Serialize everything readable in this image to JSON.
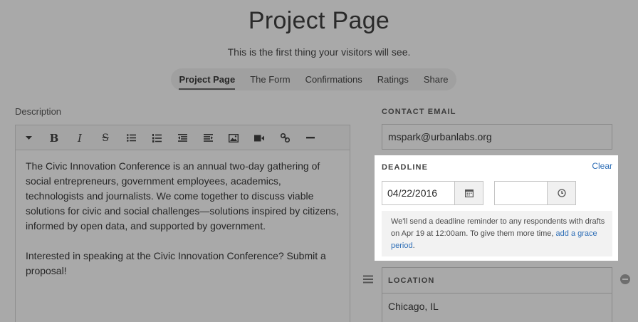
{
  "header": {
    "title": "Project Page",
    "subtitle": "This is the first thing your visitors will see."
  },
  "tabs": [
    {
      "label": "Project Page",
      "active": true
    },
    {
      "label": "The Form",
      "active": false
    },
    {
      "label": "Confirmations",
      "active": false
    },
    {
      "label": "Ratings",
      "active": false
    },
    {
      "label": "Share",
      "active": false
    }
  ],
  "description": {
    "label": "Description",
    "toolbar": [
      "dropdown-caret-icon",
      "bold-icon",
      "italic-icon",
      "strikethrough-icon",
      "bullet-list-icon",
      "numbered-list-icon",
      "outdent-icon",
      "indent-icon",
      "image-icon",
      "video-icon",
      "link-icon",
      "horizontal-rule-icon"
    ],
    "paragraphs": [
      "The Civic Innovation Conference is an annual two-day gathering of social entrepreneurs, government employees, academics, technologists and journalists. We come together to discuss viable solutions for civic and social challenges—solutions inspired by citizens, informed by open data, and supported by government.",
      "Interested in speaking at the Civic Innovation Conference? Submit a proposal!"
    ]
  },
  "contact": {
    "label": "CONTACT EMAIL",
    "value": "mspark@urbanlabs.org"
  },
  "deadline": {
    "label": "DEADLINE",
    "clear": "Clear",
    "date": "04/22/2016",
    "time": "",
    "notice_text": "We'll send a deadline reminder to any respondents with drafts on Apr 19 at 12:00am. To give them more time, ",
    "notice_link": "add a grace period",
    "notice_end": "."
  },
  "location": {
    "label": "LOCATION",
    "value": "Chicago, IL"
  },
  "colors": {
    "overlay": "#a9a9a9",
    "link": "#2f6fb7",
    "card": "#ffffff"
  }
}
